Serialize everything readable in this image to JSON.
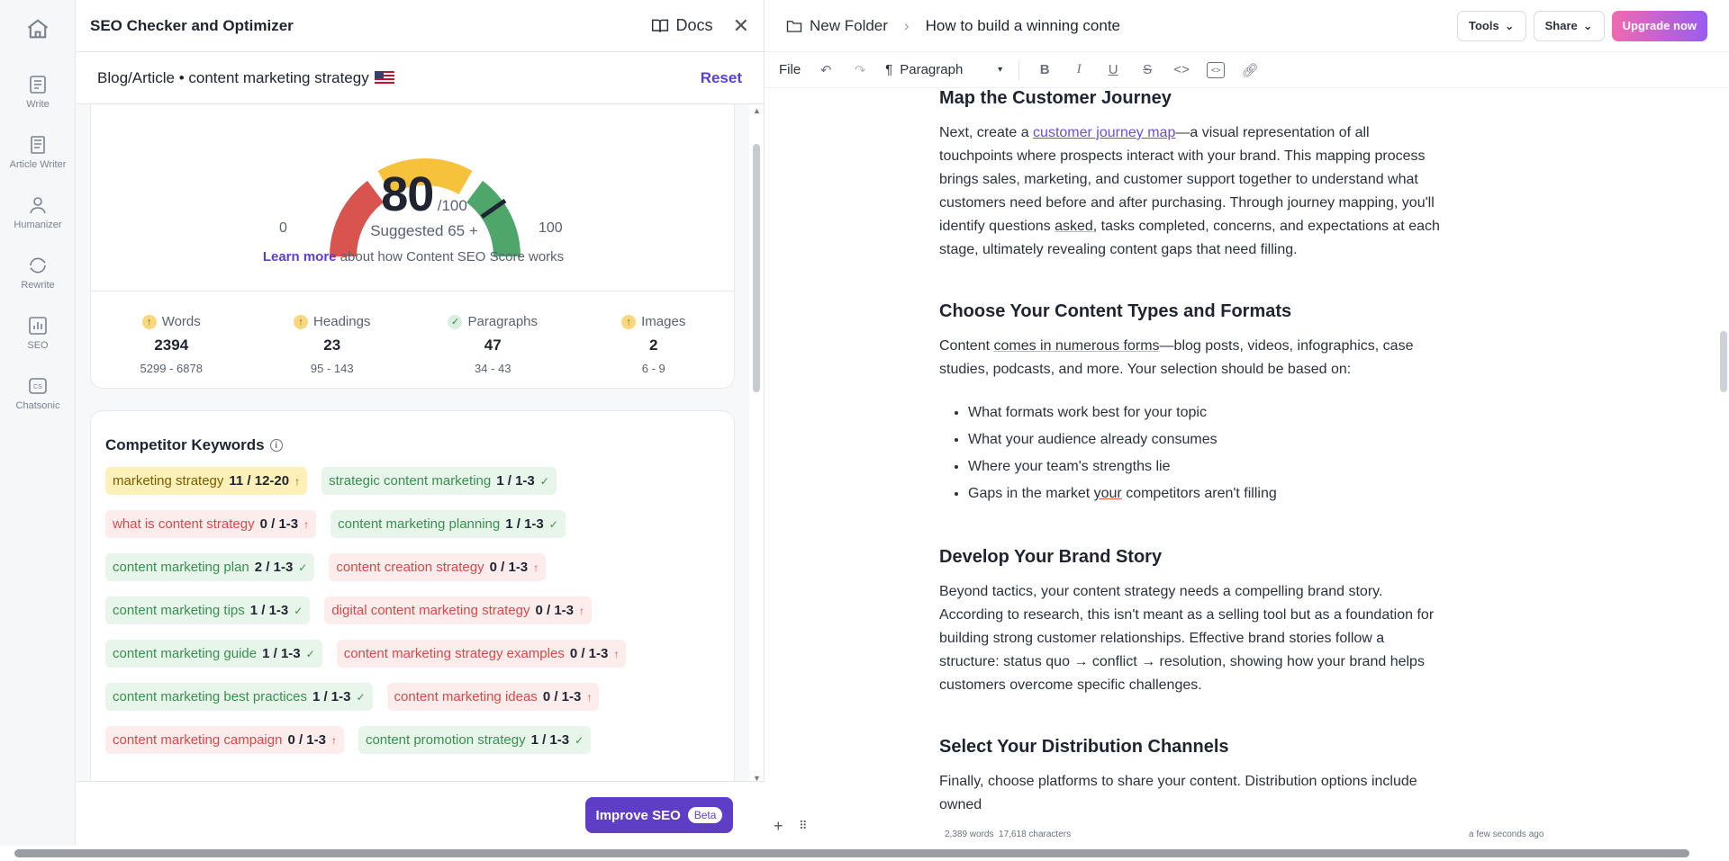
{
  "rail": {
    "items": [
      {
        "label": "Write",
        "icon": "write-icon"
      },
      {
        "label": "Article Writer",
        "icon": "article-writer-icon"
      },
      {
        "label": "Humanizer",
        "icon": "humanizer-icon"
      },
      {
        "label": "Rewrite",
        "icon": "rewrite-icon"
      },
      {
        "label": "SEO",
        "icon": "seo-icon"
      },
      {
        "label": "Chatsonic",
        "icon": "chatsonic-icon"
      }
    ]
  },
  "panel": {
    "title": "SEO Checker and Optimizer",
    "docs_label": "Docs",
    "subtitle": "Blog/Article • content marketing strategy",
    "reset_label": "Reset",
    "score": {
      "value": "80",
      "out_of": "/100",
      "suggested": "Suggested  65 +",
      "min": "0",
      "max": "100",
      "learn_more": "Learn more",
      "learn_rest": "about how Content SEO Score works"
    },
    "stats": [
      {
        "label": "Words",
        "value": "2394",
        "range": "5299 - 6878",
        "status": "up"
      },
      {
        "label": "Headings",
        "value": "23",
        "range": "95 - 143",
        "status": "up"
      },
      {
        "label": "Paragraphs",
        "value": "47",
        "range": "34 - 43",
        "status": "ok"
      },
      {
        "label": "Images",
        "value": "2",
        "range": "6 - 9",
        "status": "up"
      }
    ],
    "keywords_title": "Competitor Keywords",
    "keywords": [
      [
        {
          "text": "marketing strategy",
          "count": "11 / 12-20",
          "color": "yellow"
        },
        {
          "text": "strategic content marketing",
          "count": "1 / 1-3",
          "color": "green"
        }
      ],
      [
        {
          "text": "what is content strategy",
          "count": "0 / 1-3",
          "color": "red"
        },
        {
          "text": "content marketing planning",
          "count": "1 / 1-3",
          "color": "green"
        }
      ],
      [
        {
          "text": "content marketing plan",
          "count": "2 / 1-3",
          "color": "green"
        },
        {
          "text": "content creation strategy",
          "count": "0 / 1-3",
          "color": "red"
        }
      ],
      [
        {
          "text": "content marketing tips",
          "count": "1 / 1-3",
          "color": "green"
        },
        {
          "text": "digital content marketing strategy",
          "count": "0 / 1-3",
          "color": "red"
        }
      ],
      [
        {
          "text": "content marketing guide",
          "count": "1 / 1-3",
          "color": "green"
        },
        {
          "text": "content marketing strategy examples",
          "count": "0 / 1-3",
          "color": "red"
        }
      ],
      [
        {
          "text": "content marketing best practices",
          "count": "1 / 1-3",
          "color": "green"
        },
        {
          "text": "content marketing ideas",
          "count": "0 / 1-3",
          "color": "red"
        }
      ],
      [
        {
          "text": "content marketing campaign",
          "count": "0 / 1-3",
          "color": "red"
        },
        {
          "text": "content promotion strategy",
          "count": "1 / 1-3",
          "color": "green"
        }
      ]
    ],
    "improve_label": "Improve SEO",
    "beta_label": "Beta"
  },
  "editor": {
    "folder": "New Folder",
    "doc_title": "How to build a winning conte",
    "tools_label": "Tools",
    "share_label": "Share",
    "upgrade_label": "Upgrade now",
    "file_label": "File",
    "paragraph_label": "Paragraph",
    "sections": {
      "h1": "Map the Customer Journey",
      "p1_a": "Next, create a ",
      "p1_link": "customer journey map",
      "p1_b": "—a visual representation of all touchpoints where prospects interact with your brand. This mapping process brings sales, marketing, and customer support together to understand what customers need before and after purchasing. Through journey mapping, you'll identify questions ",
      "p1_c": "asked",
      "p1_d": ", tasks completed, concerns, and expectations at each stage, ultimately revealing content gaps that need filling.",
      "h2": "Choose Your Content Types and Formats",
      "p2_a": "Content ",
      "p2_b": "comes in numerous forms",
      "p2_c": "—blog posts, videos, infographics, case studies, podcasts, and more. Your selection should be based on:",
      "li1": "What formats work best for your topic",
      "li2": "What your audience already consumes",
      "li3": "Where your team's strengths lie",
      "li4_a": "Gaps in the market ",
      "li4_b": "your",
      "li4_c": " competitors aren't filling",
      "h3": "Develop Your Brand Story",
      "p3": "Beyond tactics, your content strategy needs a compelling brand story. According to research, this isn't meant as a selling tool but as a foundation for building strong customer relationships. Effective brand stories follow a structure: status quo → conflict → resolution, showing how your brand helps customers overcome specific challenges.",
      "h4": "Select Your Distribution Channels",
      "p4": "Finally, choose platforms to share your content. Distribution options include owned"
    },
    "word_count": "2,389 words",
    "char_count": "17,618 characters",
    "saved": "a few seconds ago"
  },
  "colors": {
    "accent": "#5e3ec6",
    "gauge_red": "#d9534f",
    "gauge_yellow": "#f7c23b",
    "gauge_green": "#4fa66a"
  }
}
